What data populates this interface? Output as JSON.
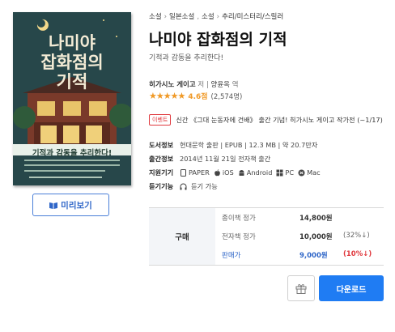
{
  "cover": {
    "title_lines": [
      "나미야",
      "잡화점의",
      "기적"
    ],
    "band_text": "기적과 감동을 추리한다!"
  },
  "preview": {
    "label": "미리보기",
    "icon": "book-open-icon"
  },
  "breadcrumb": [
    "소설",
    "일본소설",
    "소설",
    "추리/미스터리/스릴러"
  ],
  "title": "나미야 잡화점의 기적",
  "subtitle": "기적과 감동을 추리한다!",
  "author": {
    "name": "히가시노 게이고",
    "role": "저",
    "translator": "양윤옥",
    "translator_role": "역"
  },
  "rating": {
    "stars": "★★★★★",
    "score": "4.6점",
    "count": "(2,574명)",
    "value": 4.6
  },
  "event": {
    "badge": "이벤트",
    "text": "신간 《그대 눈동자에 건배》 출간 기념! 히가시노 게이고 작가전 (~1/17)"
  },
  "info": {
    "book": {
      "label": "도서정보",
      "value": "현대문학 출판 | EPUB | 12.3 MB | 약 20.7만자"
    },
    "pub": {
      "label": "출간정보",
      "value": "2014년 11월 21일 전자책 출간"
    },
    "devices": {
      "label": "지원기기",
      "items": [
        "PAPER",
        "iOS",
        "Android",
        "PC",
        "Mac"
      ]
    },
    "listen": {
      "label": "듣기기능",
      "value": "듣기 가능"
    }
  },
  "price": {
    "buy_label": "구매",
    "paper": {
      "label": "종이책 정가",
      "value": "14,800원",
      "discount": ""
    },
    "ebook": {
      "label": "전자책 정가",
      "value": "10,000원",
      "discount": "(32%↓)"
    },
    "sale": {
      "label": "판매가",
      "value": "9,000원",
      "discount": "(10%↓)"
    }
  },
  "actions": {
    "download": "다운로드",
    "gift_icon": "gift-icon"
  },
  "colors": {
    "accent": "#1f7cf3",
    "star": "#f09926",
    "red": "#e0393e",
    "link": "#2f66c8"
  }
}
